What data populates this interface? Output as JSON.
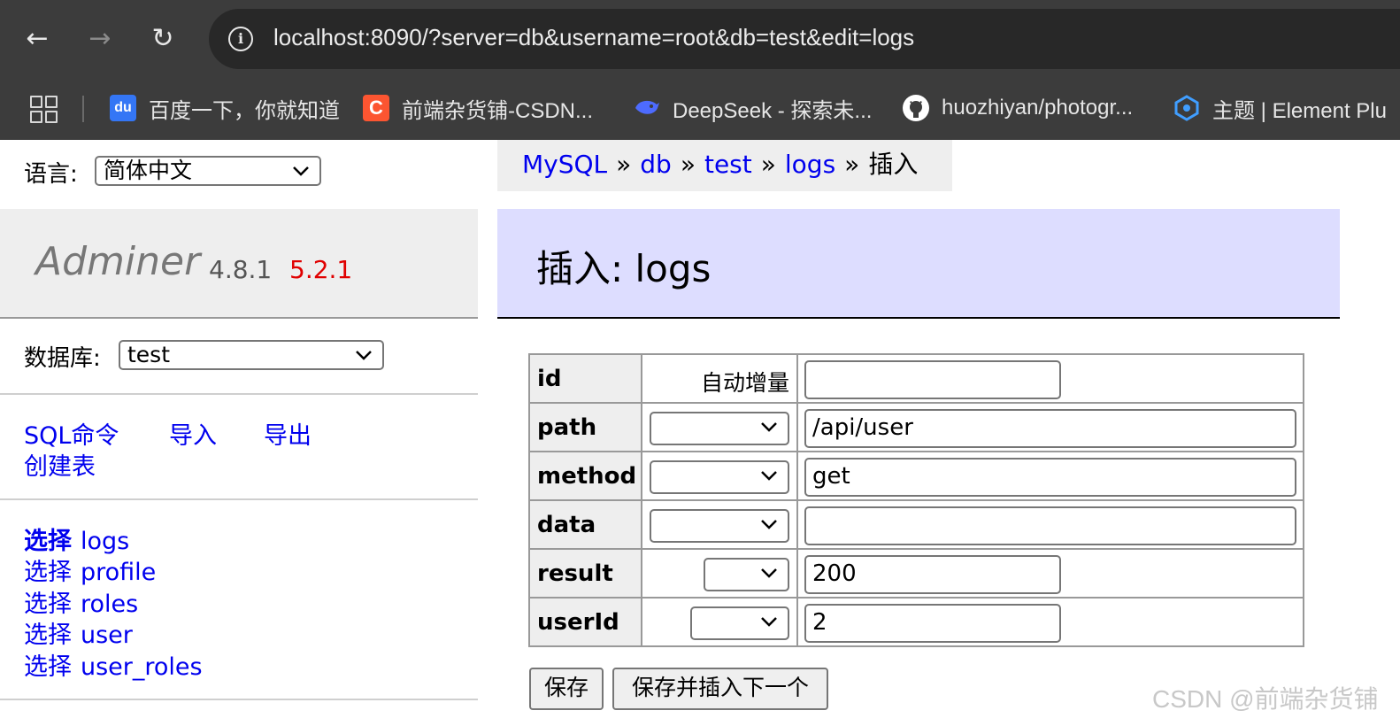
{
  "browser": {
    "url": "localhost:8090/?server=db&username=root&db=test&edit=logs",
    "bookmarks": [
      {
        "label": "百度一下，你就知道",
        "icon": "baidu-icon",
        "color": "#3476f5"
      },
      {
        "label": "前端杂货铺-CSDN...",
        "icon": "csdn-icon",
        "color": "#fc5531"
      },
      {
        "label": "DeepSeek - 探索未...",
        "icon": "deepseek-icon",
        "color": "#4d6bfe"
      },
      {
        "label": "huozhiyan/photogr...",
        "icon": "github-icon",
        "color": "#ffffff"
      },
      {
        "label": "主题 | Element Plu",
        "icon": "element-plus-icon",
        "color": "#409eff"
      }
    ]
  },
  "sidebar": {
    "lang_label": "语言:",
    "lang_value": "简体中文",
    "logo_name": "Adminer",
    "version": "4.8.1",
    "new_version": "5.2.1",
    "db_label": "数据库:",
    "db_value": "test",
    "links": [
      "SQL命令",
      "导入",
      "导出",
      "创建表"
    ],
    "select_word": "选择",
    "tables": [
      "logs",
      "profile",
      "roles",
      "user",
      "user_roles"
    ]
  },
  "breadcrumb": {
    "items": [
      "MySQL",
      "db",
      "test",
      "logs"
    ],
    "separator": "»",
    "current": "插入"
  },
  "main": {
    "title": "插入: logs",
    "fields": [
      {
        "name": "id",
        "func": "自动增量",
        "value": ""
      },
      {
        "name": "path",
        "func": "",
        "value": "/api/user"
      },
      {
        "name": "method",
        "func": "",
        "value": "get"
      },
      {
        "name": "data",
        "func": "",
        "value": ""
      },
      {
        "name": "result",
        "func": "",
        "value": "200"
      },
      {
        "name": "userId",
        "func": "",
        "value": "2"
      }
    ],
    "save_label": "保存",
    "save_insert_label": "保存并插入下一个"
  },
  "watermark": "CSDN @前端杂货铺",
  "colors": {
    "link": "#0000ee",
    "new_version": "#e00000",
    "title_bg": "#ddddff"
  }
}
